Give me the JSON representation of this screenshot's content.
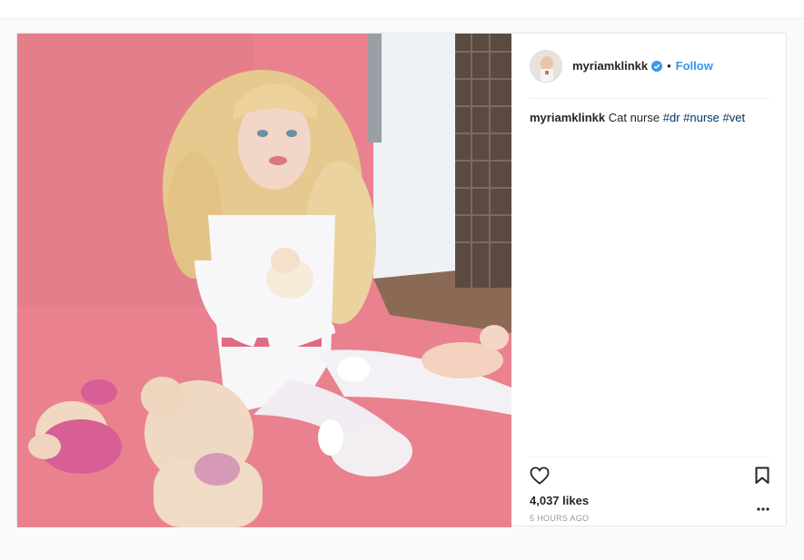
{
  "post": {
    "username": "myriamklinkk",
    "separator": "•",
    "follow_label": "Follow",
    "caption": {
      "username": "myriamklinkk",
      "text": "Cat nurse",
      "hashtags": [
        "#dr",
        "#nurse",
        "#vet"
      ]
    },
    "likes": "4,037 likes",
    "timestamp": "5 HOURS AGO"
  },
  "icons": {
    "verified": "verified-badge-icon",
    "like": "heart-icon",
    "save": "bookmark-icon",
    "more": "more-options-icon"
  },
  "colors": {
    "accent": "#3897f0",
    "hashtag": "#003569",
    "photo_background": "#e8848f",
    "muted": "#999999"
  }
}
